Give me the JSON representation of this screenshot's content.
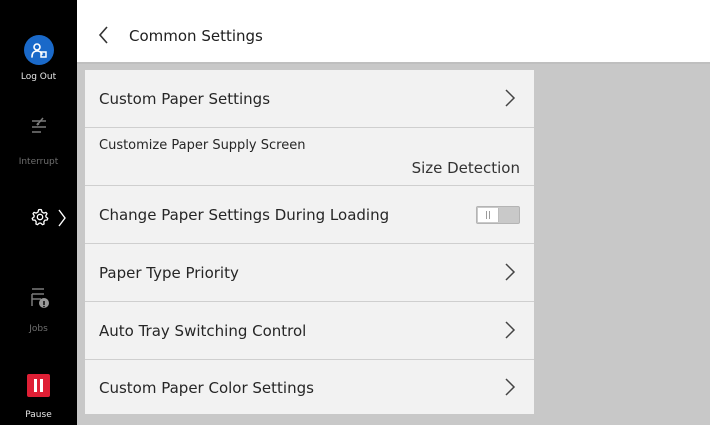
{
  "sidebar": {
    "logout_label": "Log Out",
    "interrupt_label": "Interrupt",
    "jobs_label": "Jobs",
    "pause_label": "Pause",
    "settings_icon": "gear-icon",
    "logout_icon": "user-logout-icon",
    "interrupt_icon": "interrupt-icon",
    "jobs_icon": "jobs-icon",
    "pause_icon": "pause-icon",
    "colors": {
      "background": "#000000",
      "logout": "#1a69c9",
      "pause": "#df1f35"
    }
  },
  "header": {
    "title": "Common Settings",
    "back_icon": "chevron-left-icon"
  },
  "settings": {
    "items": [
      {
        "label": "Custom Paper Settings",
        "control": "chevron-right-icon"
      },
      {
        "label": "Customize Paper Supply Screen",
        "value": "Size Detection"
      },
      {
        "label": "Change Paper Settings During Loading",
        "control": "toggle",
        "state": "off"
      },
      {
        "label": "Paper Type Priority",
        "control": "chevron-right-icon"
      },
      {
        "label": "Auto Tray Switching Control",
        "control": "chevron-right-icon"
      },
      {
        "label": "Custom Paper Color Settings",
        "control": "chevron-right-icon"
      }
    ]
  }
}
